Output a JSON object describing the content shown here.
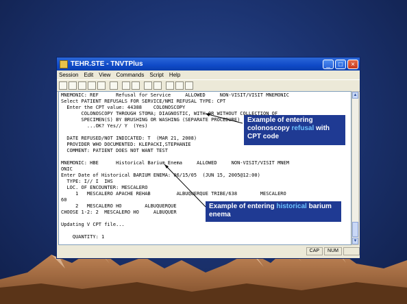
{
  "window": {
    "title": "TEHR.STE - TNVTPlus",
    "menu": [
      "Session",
      "Edit",
      "View",
      "Commands",
      "Script",
      "Help"
    ]
  },
  "terminal_lines": [
    "MNEMONIC: REF      Refusal for Service     ALLOWED     NON-VISIT/VISIT MNEMONIC",
    "Select PATIENT REFUSALS FOR SERVICE/NMI REFUSAL TYPE: CPT",
    "  Enter the CPT value: 44388    COLONOSCOPY",
    "       COLONOSCOPY THROUGH STOMA; DIAGNOSTIC, WITH OR WITHOUT COLLECTION OF",
    "       SPECIMEN(S) BY BRUSHING OR WASHING (SEPARATE PROCEDURE)",
    "         ...OK? Yes// Y  (Yes)",
    "",
    "  DATE REFUSED/NOT INDICATED: T  (MAR 21, 2008)",
    "  PROVIDER WHO DOCUMENTED: KLEPACKI,STEPHANIE",
    "  COMMENT: PATIENT DOES NOT WANT TEST",
    "",
    "MNEMONIC: HBE      Historical Barium Enema     ALLOWED     NON-VISIT/VISIT MNEM",
    "ONIC",
    "Enter Date of Historical BARIUM ENEMA: 06/15/05  (JUN 15, 2005@12:00)",
    "  TYPE: I// I  IHS",
    "  LOC. OF ENCOUNTER: MESCALERO",
    "     1   MESCALERO APACHE REHAB         ALBUQUERQUE TRIBE/638        MESCALERO",
    "60",
    "     2   MESCALERO HO        ALBUQUERQUE",
    "CHOOSE 1-2: 2  MESCALERO HO     ALBUQUER",
    "",
    "Updating V CPT file...",
    "",
    "    QUANTITY: 1"
  ],
  "statusbar": {
    "caps": "CAP",
    "num": "NUM"
  },
  "callouts": {
    "colonoscopy": {
      "part1": "Example of entering colonoscopy ",
      "highlight": "refusal",
      "part2": " with CPT code"
    },
    "barium": {
      "part1": "Example of entering ",
      "highlight": "historical",
      "part2": " barium enema"
    }
  },
  "colors": {
    "callout_bg": "#1f3a93",
    "highlight": "#6ec3ff",
    "titlebar": "#0f4ac8"
  }
}
